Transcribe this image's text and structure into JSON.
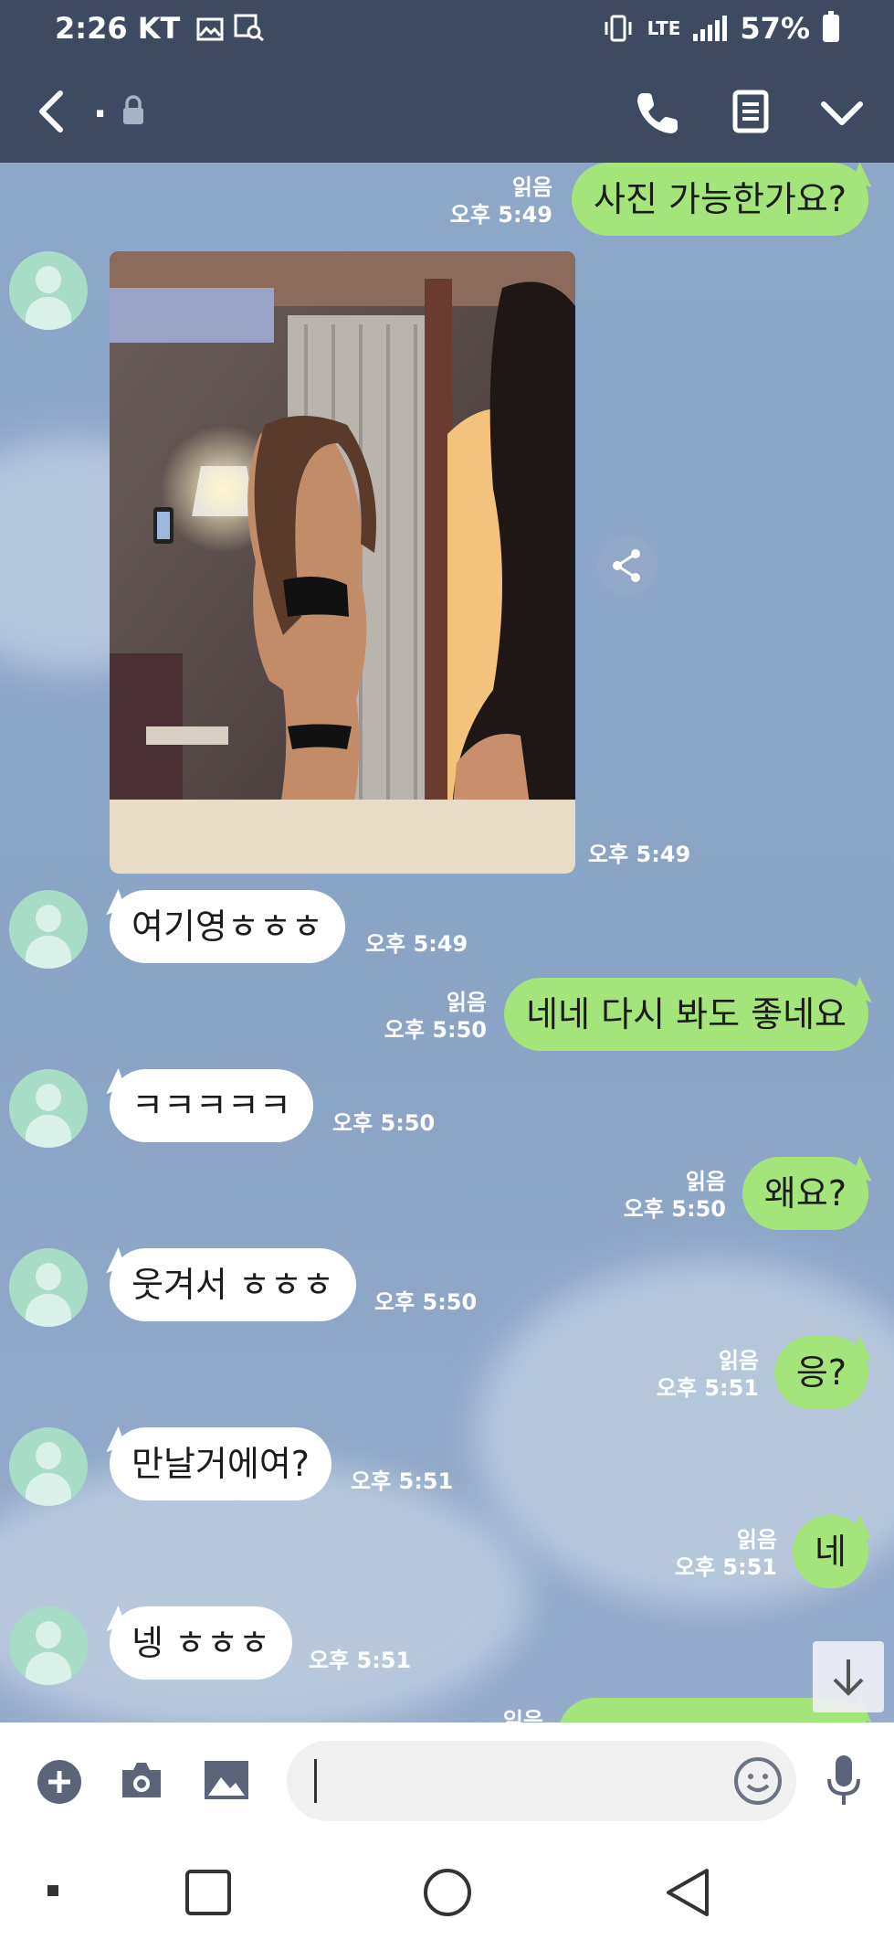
{
  "status_bar": {
    "time": "2:26",
    "carrier": "KT",
    "network": "LTE",
    "battery": "57%"
  },
  "header": {
    "title": "."
  },
  "messages": [
    {
      "id": "m1",
      "direction": "out",
      "text": "사진 가능한가요?",
      "read": "읽음",
      "time": "오후 5:49"
    },
    {
      "id": "m2",
      "direction": "in",
      "type": "image",
      "time": "오후 5:49"
    },
    {
      "id": "m3",
      "direction": "in",
      "text": "여기영ㅎㅎㅎ",
      "time": "오후 5:49"
    },
    {
      "id": "m4",
      "direction": "out",
      "text": "네네 다시 봐도 좋네요",
      "read": "읽음",
      "time": "오후 5:50"
    },
    {
      "id": "m5",
      "direction": "in",
      "text": "ㅋㅋㅋㅋㅋ",
      "time": "오후 5:50"
    },
    {
      "id": "m6",
      "direction": "out",
      "text": "왜요?",
      "read": "읽음",
      "time": "오후 5:50"
    },
    {
      "id": "m7",
      "direction": "in",
      "text": "웃겨서 ㅎㅎㅎ",
      "time": "오후 5:50"
    },
    {
      "id": "m8",
      "direction": "out",
      "text": "응?",
      "read": "읽음",
      "time": "오후 5:51"
    },
    {
      "id": "m9",
      "direction": "in",
      "text": "만날거에여?",
      "time": "오후 5:51"
    },
    {
      "id": "m10",
      "direction": "out",
      "text": "네",
      "read": "읽음",
      "time": "오후 5:51"
    },
    {
      "id": "m11",
      "direction": "in",
      "text": "넹 ㅎㅎㅎ",
      "time": "오후 5:51"
    },
    {
      "id": "m12",
      "direction": "out",
      "text": "",
      "read": "읽음",
      "partial": true
    }
  ],
  "input": {
    "value": "",
    "placeholder": ""
  },
  "colors": {
    "header": "#3e4a62",
    "chat_background": "#8aa3c6",
    "outgoing_bubble": "#a3e57a",
    "incoming_bubble": "#ffffff"
  },
  "icons": {
    "status": [
      "gallery-icon",
      "scan-icon",
      "vibrate-icon",
      "signal-icon",
      "battery-icon"
    ],
    "header": [
      "back-icon",
      "lock-icon",
      "call-icon",
      "notes-icon",
      "chevron-down-icon"
    ],
    "input_bar": [
      "add-icon",
      "camera-icon",
      "image-icon",
      "emoji-icon",
      "mic-icon"
    ],
    "nav_bar": [
      "recent-dot-icon",
      "overview-icon",
      "home-icon",
      "back-nav-icon"
    ]
  }
}
